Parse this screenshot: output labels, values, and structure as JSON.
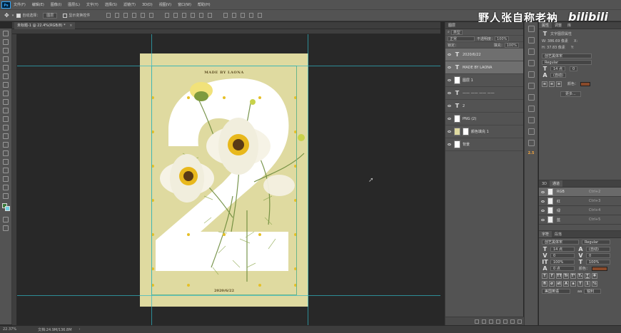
{
  "menubar": {
    "app_badge": "Ps",
    "items": [
      "文件(F)",
      "编辑(E)",
      "图像(I)",
      "图层(L)",
      "文字(Y)",
      "选择(S)",
      "滤镜(T)",
      "3D(D)",
      "视图(V)",
      "窗口(W)",
      "帮助(H)"
    ]
  },
  "optionsbar": {
    "auto_select_label": "自动选择：",
    "auto_select_value": "图层",
    "show_transform_label": "显示变换控件"
  },
  "watermark": {
    "text": "野人张自称老衲",
    "brand": "bilibili"
  },
  "document": {
    "tab_label": "未标题-1 @ 22.4%(RGB/8) *"
  },
  "poster": {
    "title": "MADE BY LAONA",
    "date": "2020/6/22",
    "numeral": "2",
    "background_color": "#dfdaa0"
  },
  "statusbar": {
    "zoom": "22.37%",
    "doc_info": "文档:24.9M/136.8M"
  },
  "layers_panel": {
    "tab_label": "图层",
    "filter_label": "类型",
    "blend_mode": "正常",
    "opacity_label": "不透明度：",
    "opacity_value": "100%",
    "lock_label": "锁定：",
    "fill_label": "填充：",
    "fill_value": "100%",
    "layers": [
      {
        "type": "text",
        "name": "2020/6/22",
        "selected": true
      },
      {
        "type": "text",
        "name": "MADE BY LAONA",
        "selected": true
      },
      {
        "type": "image",
        "name": "图层 1",
        "selected": false
      },
      {
        "type": "text",
        "name": "—— —— —— ——",
        "selected": false
      },
      {
        "type": "text",
        "name": "2",
        "selected": false
      },
      {
        "type": "image",
        "name": "PNG (2)",
        "selected": false
      },
      {
        "type": "fill",
        "name": "颜色填充 1",
        "selected": false
      },
      {
        "type": "image",
        "name": "背景",
        "selected": false
      }
    ]
  },
  "iconstrip": {
    "badge": "2.5"
  },
  "properties_panel": {
    "tabs": [
      "属性",
      "调整",
      "库"
    ],
    "header": "文字图层属性",
    "width_label": "W: 386.69 像素",
    "height_label": "H: 37.83 像素",
    "x_label": "X:",
    "y_label": "Y:",
    "font": "创艺黑体宋",
    "style": "Regular",
    "size": "14 点",
    "leading": "(自动)",
    "tracking": "0",
    "color_label": "颜色：",
    "color": "#8a4a2a",
    "more_button": "更多..."
  },
  "channels_panel": {
    "tabs": [
      "3D",
      "通道"
    ],
    "channels": [
      {
        "name": "RGB",
        "key": "Ctrl+2",
        "selected": true
      },
      {
        "name": "红",
        "key": "Ctrl+3",
        "selected": false
      },
      {
        "name": "绿",
        "key": "Ctrl+4",
        "selected": false
      },
      {
        "name": "蓝",
        "key": "Ctrl+5",
        "selected": false
      }
    ]
  },
  "character_panel": {
    "tabs": [
      "字符",
      "段落"
    ],
    "font": "创艺黑体宋",
    "style": "Regular",
    "size": "14 点",
    "leading": "(自动)",
    "kerning": "0",
    "tracking": "0",
    "vertical_scale": "100%",
    "horizontal_scale": "100%",
    "baseline": "0 点",
    "color_label": "颜色：",
    "color": "#8a4a2a",
    "language": "美国英语",
    "antialias": "锐利",
    "aa_prefix": "aa",
    "style_buttons": [
      "T",
      "T",
      "TT",
      "Tr",
      "T¹",
      "T₁",
      "T",
      "T"
    ]
  },
  "colors": {
    "accent_orange": "#f4a640",
    "guide": "#2fb6c4",
    "bilibili_pink": "#fb7299"
  }
}
